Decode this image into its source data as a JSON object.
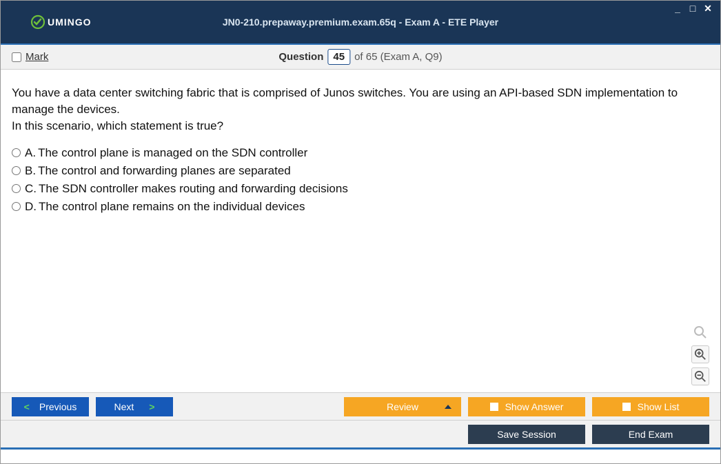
{
  "window": {
    "title": "JN0-210.prepaway.premium.exam.65q - Exam A - ETE Player",
    "logo_text": "UMINGO"
  },
  "infobar": {
    "mark_label": "Mark",
    "question_word": "Question",
    "question_number": "45",
    "of_text": "of 65 (Exam A, Q9)"
  },
  "question": {
    "text_line1": "You have a data center switching fabric that is comprised of Junos switches. You are using an API-based SDN implementation to manage the devices.",
    "text_line2": "In this scenario, which statement is true?"
  },
  "options": [
    {
      "letter": "A.",
      "text": "The control plane is managed on the SDN controller"
    },
    {
      "letter": "B.",
      "text": "The control and forwarding planes are separated"
    },
    {
      "letter": "C.",
      "text": "The SDN controller makes routing and forwarding decisions"
    },
    {
      "letter": "D.",
      "text": "The control plane remains on the individual devices"
    }
  ],
  "buttons": {
    "previous": "Previous",
    "next": "Next",
    "review": "Review",
    "show_answer": "Show Answer",
    "show_list": "Show List",
    "save_session": "Save Session",
    "end_exam": "End Exam"
  }
}
